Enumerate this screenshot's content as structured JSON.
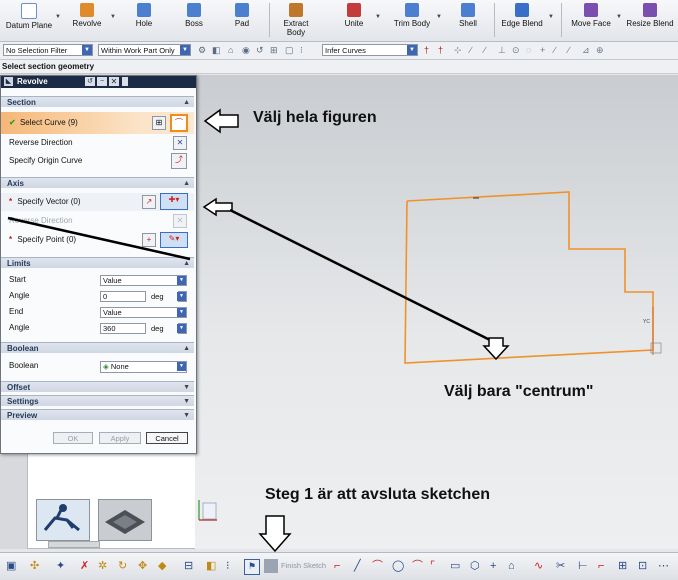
{
  "ribbon": {
    "buttons": [
      {
        "label": "Datum Plane",
        "icon": "datum-plane-icon",
        "color": "#6f8fc8"
      },
      {
        "label": "Revolve",
        "icon": "revolve-icon",
        "color": "#e08a2e"
      },
      {
        "label": "Hole",
        "icon": "hole-icon",
        "color": "#4d7fd0"
      },
      {
        "label": "Boss",
        "icon": "boss-icon",
        "color": "#4d7fd0"
      },
      {
        "label": "Pad",
        "icon": "pad-icon",
        "color": "#4d7fd0"
      },
      {
        "label": "Extract Body",
        "icon": "extract-body-icon",
        "color": "#c0772c"
      },
      {
        "label": "Unite",
        "icon": "unite-icon",
        "color": "#c33b3b"
      },
      {
        "label": "Trim Body",
        "icon": "trim-body-icon",
        "color": "#4d7fd0"
      },
      {
        "label": "Shell",
        "icon": "shell-icon",
        "color": "#4d7fd0"
      },
      {
        "label": "Edge Blend",
        "icon": "edge-blend-icon",
        "color": "#3a6fc9"
      },
      {
        "label": "Move Face",
        "icon": "move-face-icon",
        "color": "#7a4fb0"
      },
      {
        "label": "Resize Blend",
        "icon": "resize-blend-icon",
        "color": "#7a4fb0"
      }
    ]
  },
  "filterbar": {
    "selection_filter": "No Selection Filter",
    "scope": "Within Work Part Only",
    "curve_rule": "Infer Curves"
  },
  "cue": "Select section geometry",
  "dialog": {
    "title": "Revolve",
    "sections": {
      "section": "Section",
      "axis": "Axis",
      "limits": "Limits",
      "boolean": "Boolean",
      "offset": "Offset",
      "settings": "Settings",
      "preview": "Preview"
    },
    "select_curve": "Select Curve (9)",
    "reverse_direction": "Reverse Direction",
    "specify_origin_curve": "Specify Origin Curve",
    "specify_vector": "Specify Vector (0)",
    "axis_reverse_direction": "Reverse Direction",
    "specify_point": "Specify Point (0)",
    "limits": {
      "start_label": "Start",
      "start_value": "Value",
      "angle1_label": "Angle",
      "angle1_value": "0",
      "angle1_unit": "deg",
      "end_label": "End",
      "end_value": "Value",
      "angle2_label": "Angle",
      "angle2_value": "360",
      "angle2_unit": "deg"
    },
    "boolean_label": "Boolean",
    "boolean_value": "None",
    "buttons": {
      "ok": "OK",
      "apply": "Apply",
      "cancel": "Cancel"
    }
  },
  "annotations": {
    "select_whole": "Välj hela figuren",
    "select_center": "Välj bara \"centrum\"",
    "step1": "Steg 1 är att avsluta sketchen"
  },
  "bottombar": {
    "finish_sketch": "Finish Sketch"
  },
  "colors": {
    "sketch_orange": "#f0922b",
    "dialog_title_bg": "#1c2b45",
    "selected_row": "#f3c58e"
  }
}
